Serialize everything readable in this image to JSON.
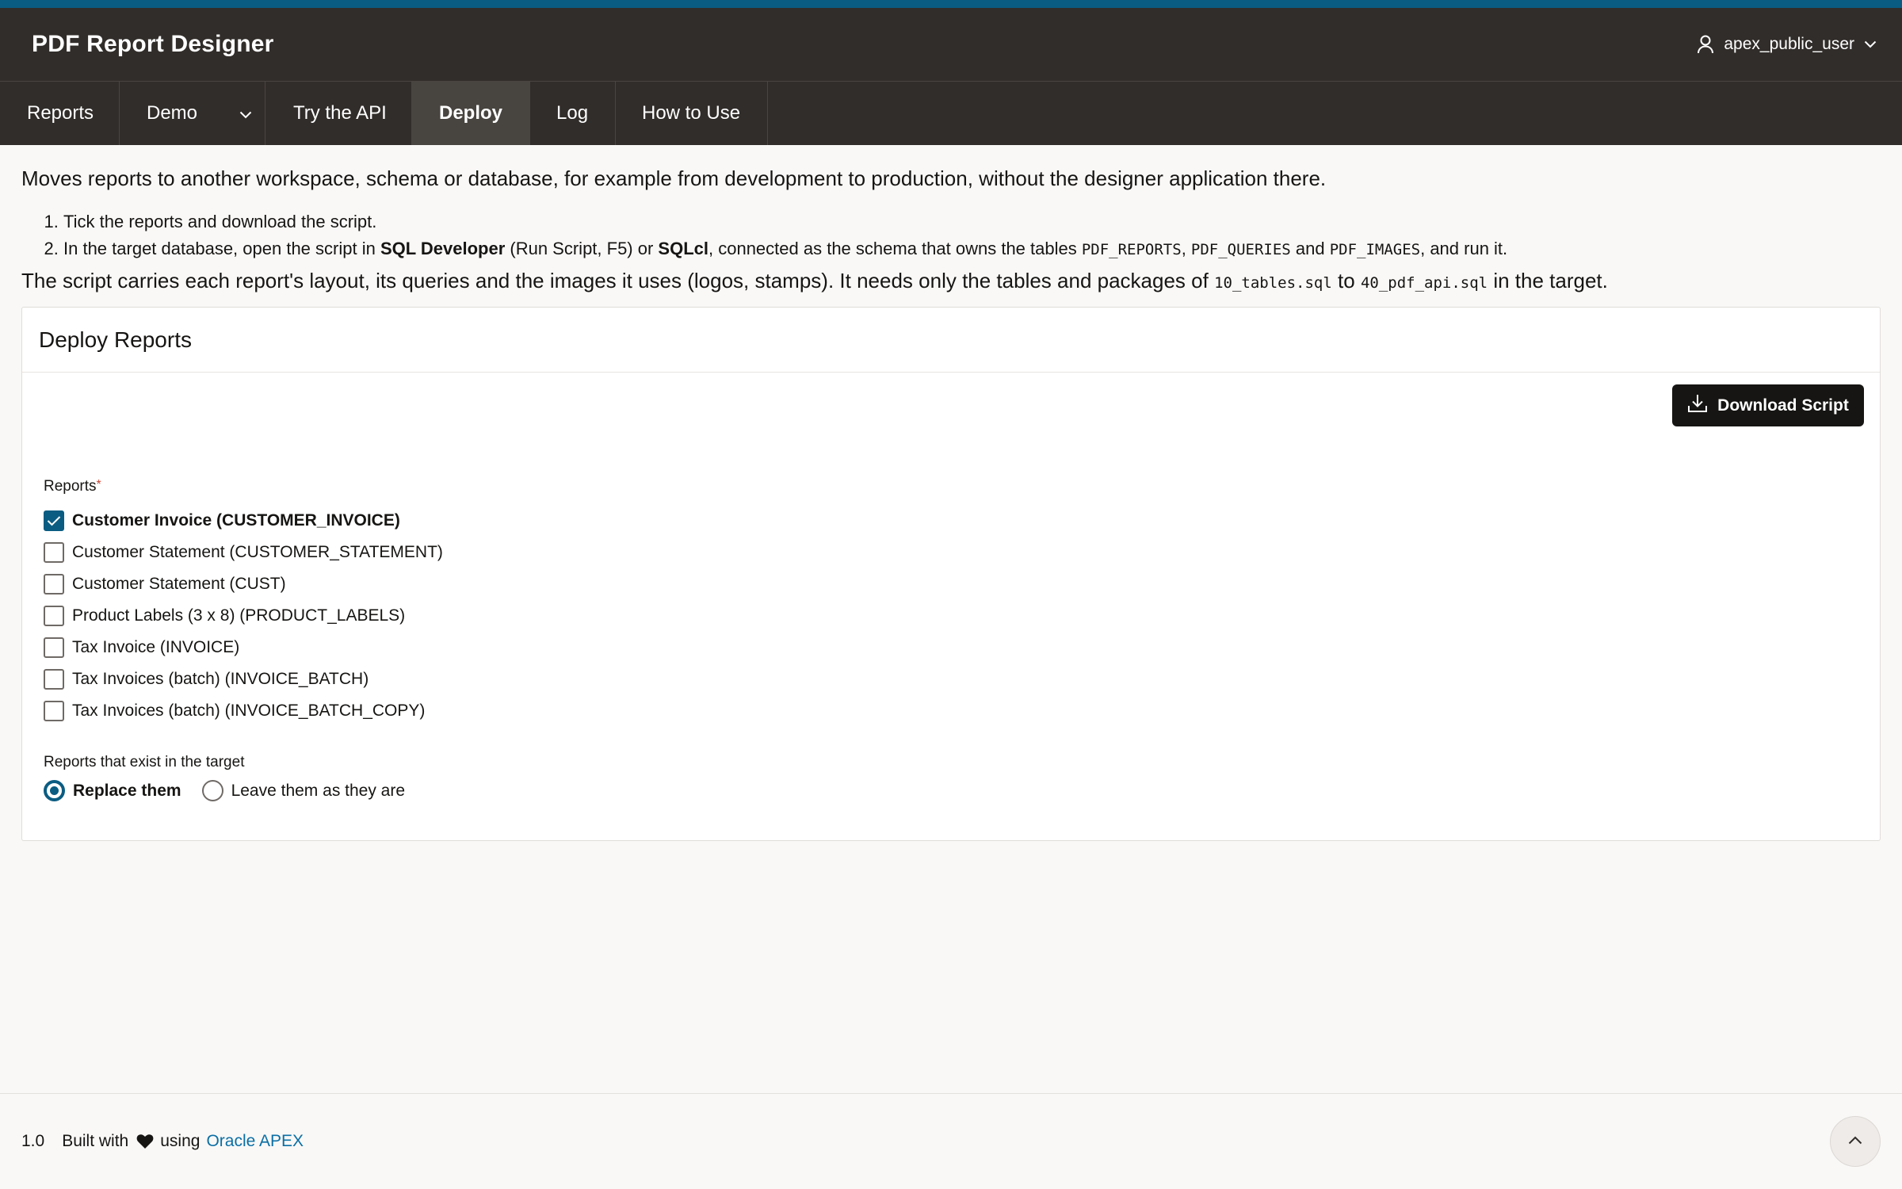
{
  "app": {
    "title": "PDF Report Designer",
    "user": "apex_public_user"
  },
  "nav": [
    {
      "label": "Reports"
    },
    {
      "label": "Demo"
    },
    {
      "label": "Try the API"
    },
    {
      "label": "Deploy"
    },
    {
      "label": "Log"
    },
    {
      "label": "How to Use"
    }
  ],
  "intro": {
    "lead": "Moves reports to another workspace, schema or database, for example from development to production, without the designer application there.",
    "step1": "Tick the reports and download the script.",
    "step2": {
      "a": "In the target database, open the script in ",
      "b": "SQL Developer",
      "c": " (Run Script, F5) or ",
      "d": "SQLcl",
      "e": ", connected as the schema that owns the tables ",
      "t1": "PDF_REPORTS",
      "sep1": ", ",
      "t2": "PDF_QUERIES",
      "sep2": " and ",
      "t3": "PDF_IMAGES",
      "f": ", and run it."
    },
    "carry": {
      "a": "The script carries each report's layout, its queries and the images it uses (logos, stamps). It needs only the tables and packages of ",
      "f1": "10_tables.sql",
      "b": " to ",
      "f2": "40_pdf_api.sql",
      "c": " in the target."
    }
  },
  "card": {
    "title": "Deploy Reports",
    "download_label": "Download Script",
    "reports_label": "Reports",
    "required_mark": "*",
    "reports": [
      {
        "label": "Customer Invoice (CUSTOMER_INVOICE)",
        "checked": true
      },
      {
        "label": "Customer Statement (CUSTOMER_STATEMENT)",
        "checked": false
      },
      {
        "label": "Customer Statement (CUST)",
        "checked": false
      },
      {
        "label": "Product Labels (3 x 8) (PRODUCT_LABELS)",
        "checked": false
      },
      {
        "label": "Tax Invoice (INVOICE)",
        "checked": false
      },
      {
        "label": "Tax Invoices (batch) (INVOICE_BATCH)",
        "checked": false
      },
      {
        "label": "Tax Invoices (batch) (INVOICE_BATCH_COPY)",
        "checked": false
      }
    ],
    "existing_label": "Reports that exist in the target",
    "existing_options": [
      {
        "label": "Replace them",
        "selected": true
      },
      {
        "label": "Leave them as they are",
        "selected": false
      }
    ]
  },
  "footer": {
    "version": "1.0",
    "built_with": "Built with",
    "using": "using",
    "link": "Oracle APEX"
  },
  "colors": {
    "accent": "#0b5c82",
    "header": "#312d2a",
    "link": "#0b6fa4"
  }
}
